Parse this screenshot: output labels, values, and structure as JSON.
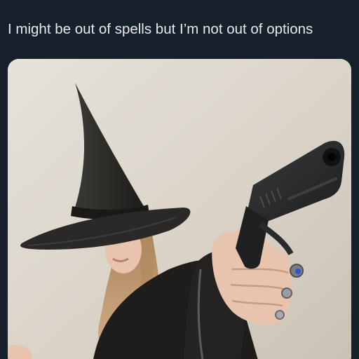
{
  "post": {
    "text": "I might be out of spells but I’m not out of options"
  },
  "media": {
    "description_icon": "photo",
    "colors": {
      "background": "#15202b",
      "text": "#e7e9ea",
      "wall": "#dcd6cc",
      "robe": "#1f1d1c",
      "hat": "#2f2e2b",
      "gun": "#2a2b2d",
      "skin": "#e8c3ad",
      "hair": "#c39a6f"
    }
  }
}
